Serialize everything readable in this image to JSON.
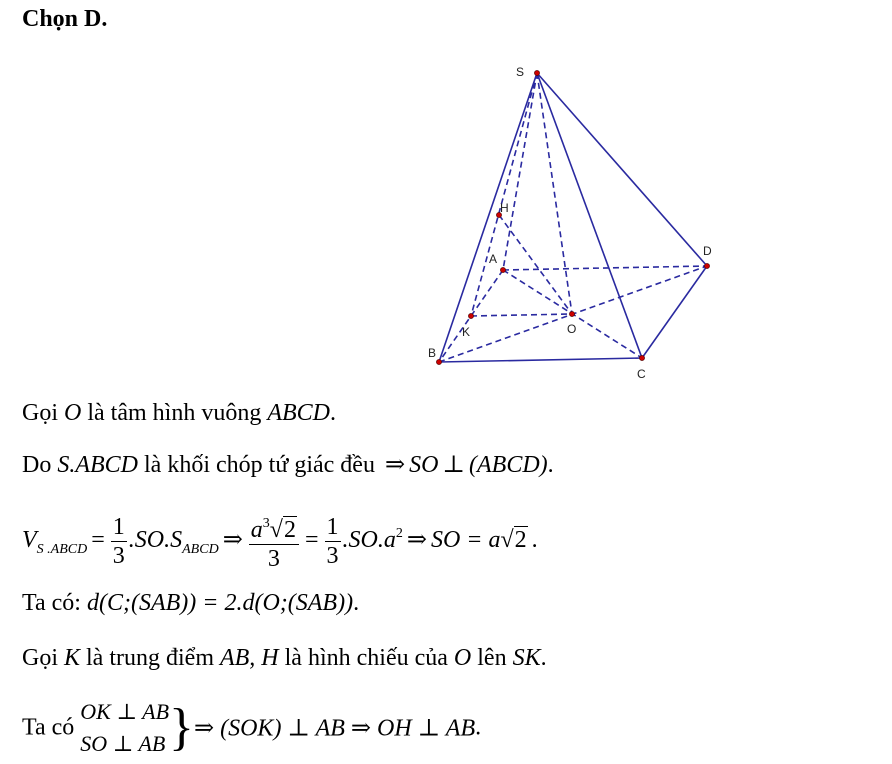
{
  "answer": "Chọn D.",
  "figure": {
    "type": "geometry-diagram",
    "description": "Regular square pyramid S.ABCD with center O, midpoint K of AB, H projection of O onto SK",
    "line_color": "#2a2aa0",
    "point_color": "#cc0000",
    "labels": {
      "S": "S",
      "A": "A",
      "B": "B",
      "C": "C",
      "D": "D",
      "O": "O",
      "K": "K",
      "H": "H"
    }
  },
  "lines": {
    "l1": {
      "pre": "Gọi ",
      "o": "O",
      "mid": " là tâm hình vuông ",
      "abcd": "ABCD",
      "post": "."
    },
    "l2": {
      "pre": "Do ",
      "sabcd": "S.ABCD",
      "mid": " là khối chóp tứ giác đều ",
      "arrow": "⇒",
      "so": "SO",
      "perp": "⊥",
      "abcd": "(ABCD)",
      "post": "."
    },
    "l3": {
      "v": "V",
      "v_sub": "S .ABCD",
      "eq": "=",
      "one": "1",
      "three": "3",
      "so_s": ".SO.S",
      "s_sub": "ABCD",
      "arrow": "⇒",
      "a": "a",
      "a_exp": "3",
      "rad2": "2",
      "eq2": "=",
      "so_a": ".SO.a",
      "a2_exp": "2",
      "arrow2": "⇒",
      "so_eq": "SO = a",
      "rad2b": "2",
      "post": "."
    },
    "l4": {
      "pre": "Ta có: ",
      "expr": "d(C;(SAB)) = 2.d(O;(SAB))",
      "post": "."
    },
    "l5": {
      "pre": "Gọi ",
      "k": "K",
      "mid1": " là trung điểm ",
      "abh": "AB, H",
      "mid2": " là hình chiếu của ",
      "o": "O",
      "mid3": " lên ",
      "sk": "SK",
      "post": "."
    },
    "l6": {
      "pre": "Ta có ",
      "row1": "OK ⊥ AB",
      "row2": "SO ⊥ AB",
      "conclusion": "⇒ (SOK) ⊥ AB ⇒ OH ⊥ AB",
      "post": "."
    }
  }
}
